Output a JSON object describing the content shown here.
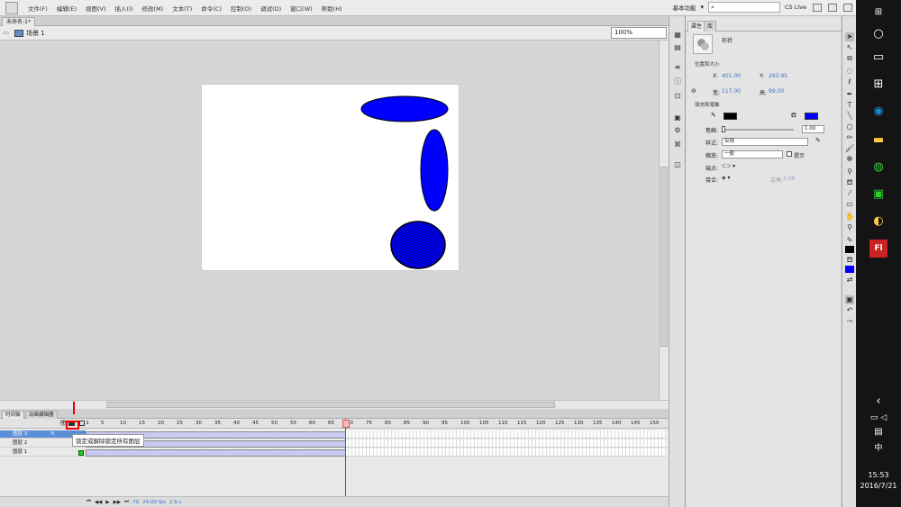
{
  "menu": {
    "items": [
      "文件(F)",
      "编辑(E)",
      "视图(V)",
      "插入(I)",
      "修改(M)",
      "文本(T)",
      "命令(C)",
      "控制(O)",
      "调试(D)",
      "窗口(W)",
      "帮助(H)"
    ],
    "workspace": "基本功能",
    "cs_live": "CS Live"
  },
  "document_tab": "未命名-1*",
  "scene": {
    "name": "场景 1",
    "zoom": "100%"
  },
  "timeline": {
    "tabs": [
      "时间轴",
      "动画编辑器"
    ],
    "frame_numbers": [
      "1",
      "5",
      "10",
      "15",
      "20",
      "25",
      "30",
      "35",
      "40",
      "45",
      "50",
      "55",
      "60",
      "65",
      "70",
      "75",
      "80",
      "85",
      "90",
      "95",
      "100",
      "105",
      "110",
      "115",
      "120",
      "125",
      "130",
      "135",
      "140",
      "145",
      "150"
    ],
    "layers": [
      "图层 3",
      "图层 2",
      "图层 1"
    ],
    "tooltip": "锁定或解除锁定所有图层",
    "current_frame": "70",
    "fps": "24.00 fps",
    "time": "2.9 s"
  },
  "properties": {
    "tabs": [
      "属性",
      "库"
    ],
    "object_type": "形状",
    "position_size_label": "位置和大小",
    "x_label": "X:",
    "x_value": "401.00",
    "y_label": "Y:",
    "y_value": "293.95",
    "w_label": "宽:",
    "w_value": "117.00",
    "h_label": "高:",
    "h_value": "99.00",
    "fill_stroke_label": "填充和笔触",
    "stroke_width_label": "笔触:",
    "stroke_width_value": "1.00",
    "style_label": "样式:",
    "style_value": "实线",
    "scale_label": "缩放:",
    "scale_value": "一般",
    "hint_label": "提示",
    "cap_label": "端点:",
    "join_label": "接合:",
    "miter_label": "尖角:",
    "miter_value": "3.00",
    "stroke_color": "#000000",
    "fill_color": "#0000ff"
  },
  "taskbar": {
    "ime": "中",
    "time": "15:53",
    "date": "2016/7/21"
  },
  "colors": {
    "shape_fill": "#0000ff",
    "stage": "#ffffff",
    "selection": "#5b8fd8"
  }
}
